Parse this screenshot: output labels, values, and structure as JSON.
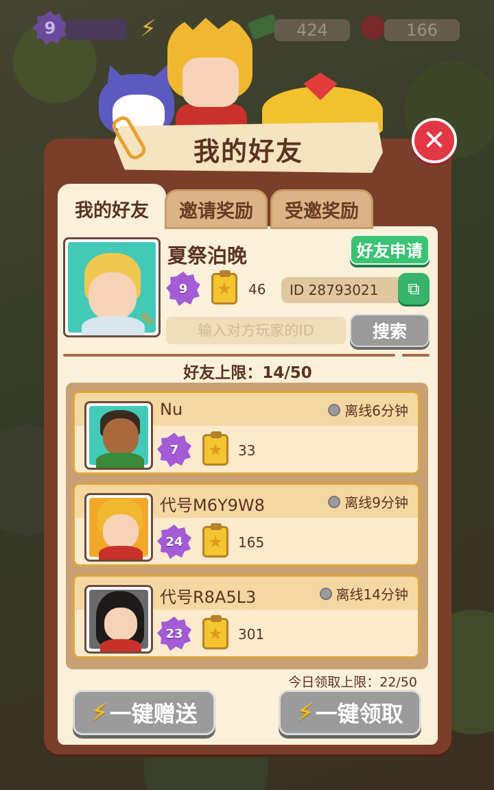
{
  "topbar": {
    "level": "9",
    "resource1": "424",
    "resource2": "166"
  },
  "title": "我的好友",
  "tabs": [
    {
      "label": "我的好友",
      "active": true
    },
    {
      "label": "邀请奖励",
      "active": false
    },
    {
      "label": "受邀奖励",
      "active": false
    }
  ],
  "profile": {
    "name": "夏祭泊晚",
    "level": "9",
    "stars": "46",
    "id_text": "ID 28793021",
    "friend_request_label": "好友申请",
    "search_placeholder": "输入对方玩家的ID",
    "search_label": "搜索"
  },
  "friend_cap_label": "好友上限：14/50",
  "friends": [
    {
      "name": "Nu",
      "status": "离线6分钟",
      "level": "7",
      "stars": "33",
      "avatar_bg": "#43c9b8",
      "skin": "#a86a3c",
      "hair": "#3a2a20",
      "shirt": "#3a8a3a"
    },
    {
      "name": "代号M6Y9W8",
      "status": "离线9分钟",
      "level": "24",
      "stars": "165",
      "avatar_bg": "#f4a82a",
      "skin": "#f6d3b8",
      "hair": "#f0b830",
      "shirt": "#c8322a"
    },
    {
      "name": "代号R8A5L3",
      "status": "离线14分钟",
      "level": "23",
      "stars": "301",
      "avatar_bg": "#6a6a6a",
      "skin": "#f6d3b8",
      "hair": "#1e1a1a",
      "shirt": "#c8322a"
    }
  ],
  "daily_cap_label": "今日领取上限：22/50",
  "buttons": {
    "send_all": "一键赠送",
    "claim_all": "一键领取"
  },
  "colors": {
    "panel": "#7a3e2a",
    "panel_inner": "#fbf0da",
    "accent_green": "#3cc273",
    "close_red": "#e23845",
    "level_purple": "#a35bd6"
  }
}
